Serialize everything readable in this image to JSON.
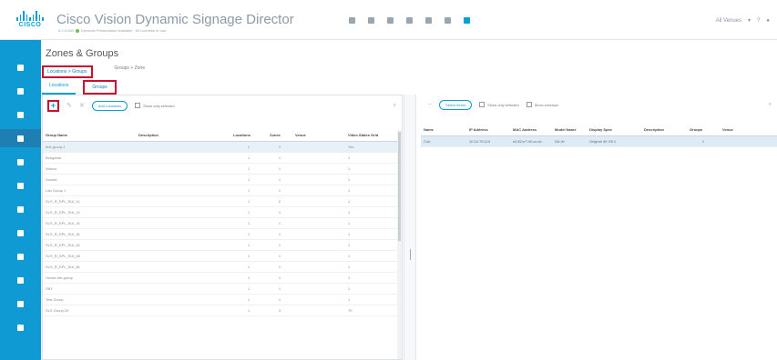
{
  "header": {
    "logo_text": "CISCO",
    "title": "Cisco Vision Dynamic Signage Director",
    "subtitle_left": "6.2.0-560",
    "subtitle_right": "Dynamic Presentation Available · All Licenses in Use",
    "user": "All Venues",
    "brand_color": "#049fd9",
    "nav_color": "#0f9ad3"
  },
  "toolbar_icons": [
    "monitor-icon",
    "cloud-icon",
    "settings-icon",
    "apps-icon",
    "chart-icon",
    "tools-icon",
    "book-icon"
  ],
  "nav_icons": [
    "pin-icon",
    "display-icon",
    "shield-icon",
    "zones-icon",
    "calendar-icon",
    "eye-icon",
    "envelope-icon",
    "target-icon",
    "phone-icon",
    "code-icon",
    "script-icon",
    "user-icon"
  ],
  "page": {
    "title": "Zones & Groups",
    "breadcrumb_1": "Locations > Groups",
    "breadcrumb_2": "Groups > Zone",
    "tab_locations": "Locations",
    "tab_groups": "Groups"
  },
  "left_toolbar": {
    "add_label": "+",
    "edit_label": "✎",
    "delete_label": "✕",
    "pill_label": "Add Locations",
    "checkbox_label": "Show only selected",
    "search_label": "⌕"
  },
  "left_table": {
    "headers": [
      "Group Name",
      "Description",
      "Locations",
      "Zones",
      "Venue",
      "Video States Grid"
    ],
    "rows": [
      [
        "test-group-1",
        "",
        "1",
        "1",
        "",
        "Yes"
      ],
      [
        "Bongania",
        "",
        "1",
        "1",
        "",
        "1"
      ],
      [
        "Wazoo",
        "",
        "1",
        "1",
        "",
        "1"
      ],
      [
        "Sunset",
        "",
        "1",
        "1",
        "",
        "1"
      ],
      [
        "Lab Group 1",
        "",
        "1",
        "1",
        "",
        "1"
      ],
      [
        "SLS_R_SPL_SUI_11",
        "",
        "1",
        "2",
        "",
        "1"
      ],
      [
        "SLS_R_SPL_SUI_21",
        "",
        "1",
        "1",
        "",
        "1"
      ],
      [
        "SLS_R_SPL_SUI_41",
        "",
        "1",
        "1",
        "",
        "1"
      ],
      [
        "SLS_R_SPL_SUI_51",
        "",
        "1",
        "1",
        "",
        "1"
      ],
      [
        "SLS_R_SPL_SUI_61",
        "",
        "1",
        "1",
        "",
        "1"
      ],
      [
        "SLS_R_SPL_SUI_63",
        "",
        "1",
        "1",
        "",
        "1"
      ],
      [
        "SLS_R_SPL_SUI_81",
        "",
        "1",
        "1",
        "",
        "1"
      ],
      [
        "Venue-the-group",
        "",
        "1",
        "1",
        "",
        "1"
      ],
      [
        "SBT",
        "",
        "1",
        "1",
        "",
        "1"
      ],
      [
        "Test Group",
        "",
        "1",
        "1",
        "",
        "1"
      ],
      [
        "SLS Group 20",
        "",
        "1",
        "4",
        "",
        "79"
      ]
    ]
  },
  "right_toolbar": {
    "minus_label": "−",
    "pill_label": "Select Items",
    "checkbox_1": "Show only selected",
    "checkbox_2": "Show overlaps",
    "search_label": "⌕"
  },
  "right_table": {
    "headers": [
      "Name",
      "IP Address",
      "MAC Address",
      "Model Name",
      "Display Spec",
      "Description",
      "Groups",
      "Venue"
    ],
    "rows": [
      [
        "Cub",
        "10.24.75.110",
        "e4:82:e7:42:cc:cb",
        "DA·W",
        "Original 4K S5.1",
        "",
        "1",
        ""
      ]
    ]
  }
}
